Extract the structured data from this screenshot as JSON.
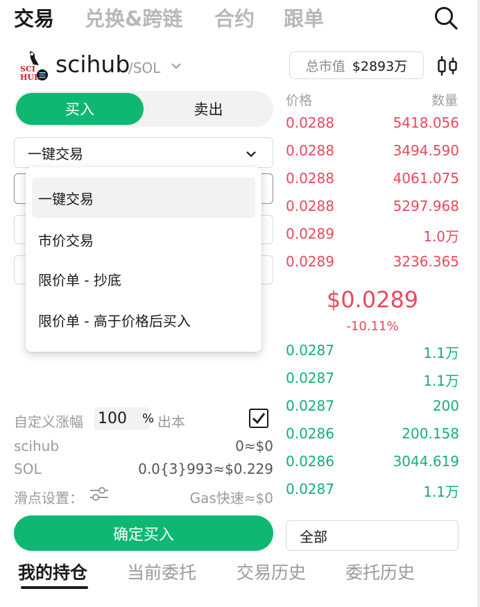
{
  "top_tabs": [
    {
      "label": "交易",
      "active": true
    },
    {
      "label": "兑换&跨链",
      "active": false
    },
    {
      "label": "合约",
      "active": false
    },
    {
      "label": "跟单",
      "active": false
    }
  ],
  "token": {
    "logo_text_top": "SCI",
    "logo_text_bottom": "HUB",
    "name": "scihub",
    "pair": "/SOL",
    "market_cap_label": "总市值",
    "market_cap_value": "$2893万"
  },
  "trade_toggle": {
    "buy": "买入",
    "sell": "卖出"
  },
  "order_type": {
    "selected": "一键交易",
    "options": [
      "一键交易",
      "市价交易",
      "限价单 - 抄底",
      "限价单 - 高于价格后买入"
    ]
  },
  "form": {
    "custom_rise_label": "自定义涨幅",
    "custom_rise_value": "100",
    "percent_sign": "%",
    "take_profit_label": "出本",
    "token_symbol": "scihub",
    "token_balance": "0≈$0",
    "sol_symbol": "SOL",
    "sol_balance": "0.0{3}993≈$0.229",
    "slippage_label": "滑点设置：",
    "gas_label": "Gas快速≈$0",
    "confirm_label": "确定买入"
  },
  "order_book": {
    "price_header": "价格",
    "qty_header": "数量",
    "asks": [
      {
        "price": "0.0288",
        "qty": "5418.056"
      },
      {
        "price": "0.0288",
        "qty": "3494.590"
      },
      {
        "price": "0.0288",
        "qty": "4061.075"
      },
      {
        "price": "0.0288",
        "qty": "5297.968"
      },
      {
        "price": "0.0289",
        "qty": "1.0万"
      },
      {
        "price": "0.0289",
        "qty": "3236.365"
      }
    ],
    "last_price": "$0.0289",
    "change": "-10.11%",
    "bids": [
      {
        "price": "0.0287",
        "qty": "1.1万"
      },
      {
        "price": "0.0287",
        "qty": "1.1万"
      },
      {
        "price": "0.0287",
        "qty": "200"
      },
      {
        "price": "0.0286",
        "qty": "200.158"
      },
      {
        "price": "0.0286",
        "qty": "3044.619"
      },
      {
        "price": "0.0287",
        "qty": "1.1万"
      }
    ],
    "filter_value": "全部"
  },
  "bottom_tabs": [
    {
      "label": "我的持仓",
      "active": true
    },
    {
      "label": "当前委托",
      "active": false
    },
    {
      "label": "交易历史",
      "active": false
    },
    {
      "label": "委托历史",
      "active": false
    }
  ],
  "colors": {
    "accent_green": "#0fb872",
    "ask_red": "#e8495b",
    "bid_green": "#14b06e"
  }
}
